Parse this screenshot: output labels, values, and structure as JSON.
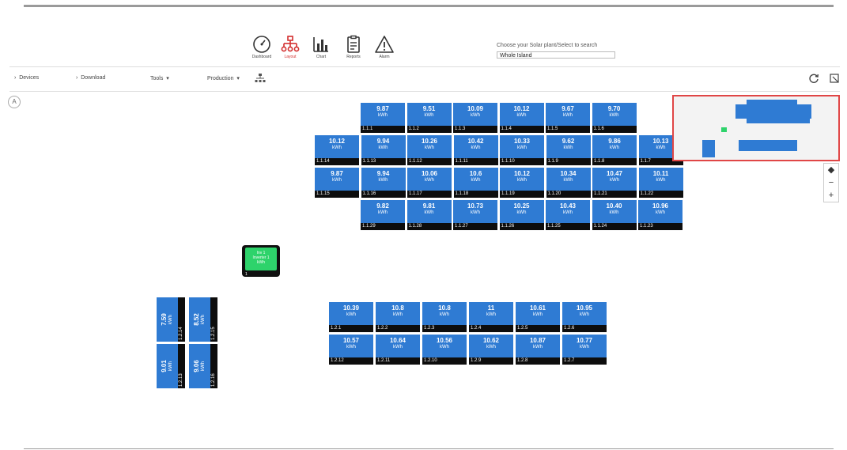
{
  "nav": [
    {
      "name": "dashboard",
      "label": "Dashboard",
      "icon": "gauge-icon"
    },
    {
      "name": "layout",
      "label": "Layout",
      "icon": "network-icon",
      "active": true
    },
    {
      "name": "chart",
      "label": "Chart",
      "icon": "bar-chart-icon"
    },
    {
      "name": "reports",
      "label": "Reports",
      "icon": "clipboard-icon"
    },
    {
      "name": "alarm",
      "label": "Alarm",
      "icon": "warning-icon"
    }
  ],
  "plant_selector": {
    "label": "Choose your Solar plant/Select to search",
    "value": "Whole Island"
  },
  "toolbar": {
    "devices": "Devices",
    "download": "Download",
    "tools": "Tools",
    "production": "Production",
    "refresh_icon": "refresh-icon",
    "fit_icon": "fit-screen-icon"
  },
  "compass": "A",
  "inverter": {
    "id": "1",
    "line1": "Inv 1",
    "line2": "Inverter 1",
    "line3": "kWh"
  },
  "array1": {
    "rows": [
      [
        {
          "v": "9.87",
          "id": "1.1.1"
        },
        {
          "v": "9.51",
          "id": "1.1.2"
        },
        {
          "v": "10.09",
          "id": "1.1.3"
        },
        {
          "v": "10.12",
          "id": "1.1.4"
        },
        {
          "v": "9.67",
          "id": "1.1.5"
        },
        {
          "v": "9.70",
          "id": "1.1.6"
        }
      ],
      [
        {
          "v": "10.12",
          "id": "1.1.14"
        },
        {
          "v": "9.94",
          "id": "1.1.13"
        },
        {
          "v": "10.26",
          "id": "1.1.12"
        },
        {
          "v": "10.42",
          "id": "1.1.11"
        },
        {
          "v": "10.33",
          "id": "1.1.10"
        },
        {
          "v": "9.62",
          "id": "1.1.9"
        },
        {
          "v": "9.86",
          "id": "1.1.8"
        },
        {
          "v": "10.13",
          "id": "1.1.7"
        }
      ],
      [
        {
          "v": "9.87",
          "id": "1.1.15"
        },
        {
          "v": "9.94",
          "id": "1.1.16"
        },
        {
          "v": "10.06",
          "id": "1.1.17"
        },
        {
          "v": "10.6",
          "id": "1.1.18"
        },
        {
          "v": "10.12",
          "id": "1.1.19"
        },
        {
          "v": "10.34",
          "id": "1.1.20"
        },
        {
          "v": "10.47",
          "id": "1.1.21"
        },
        {
          "v": "10.11",
          "id": "1.1.22"
        }
      ],
      [
        {
          "v": "9.82",
          "id": "1.1.29"
        },
        {
          "v": "9.81",
          "id": "1.1.28"
        },
        {
          "v": "10.73",
          "id": "1.1.27"
        },
        {
          "v": "10.25",
          "id": "1.1.26"
        },
        {
          "v": "10.43",
          "id": "1.1.25"
        },
        {
          "v": "10.40",
          "id": "1.1.24"
        },
        {
          "v": "10.96",
          "id": "1.1.23"
        }
      ]
    ]
  },
  "array2": {
    "rows": [
      [
        {
          "v": "10.39",
          "id": "1.2.1"
        },
        {
          "v": "10.8",
          "id": "1.2.2"
        },
        {
          "v": "10.8",
          "id": "1.2.3"
        },
        {
          "v": "11",
          "id": "1.2.4"
        },
        {
          "v": "10.61",
          "id": "1.2.5"
        },
        {
          "v": "10.95",
          "id": "1.2.6"
        }
      ],
      [
        {
          "v": "10.57",
          "id": "1.2.12"
        },
        {
          "v": "10.64",
          "id": "1.2.11"
        },
        {
          "v": "10.56",
          "id": "1.2.10"
        },
        {
          "v": "10.62",
          "id": "1.2.9"
        },
        {
          "v": "10.87",
          "id": "1.2.8"
        },
        {
          "v": "10.77",
          "id": "1.2.7"
        }
      ]
    ]
  },
  "array3": [
    {
      "v": "7.59",
      "id": "1.2.14"
    },
    {
      "v": "8.52",
      "id": "1.2.15"
    },
    {
      "v": "9.01",
      "id": "1.2.13"
    },
    {
      "v": "9.06",
      "id": "1.2.16"
    }
  ],
  "unit": "kWh",
  "colors": {
    "panel": "#2f7bd3",
    "inverter": "#2ed36b",
    "active": "#d32f2f",
    "minimap_border": "#e04646"
  }
}
